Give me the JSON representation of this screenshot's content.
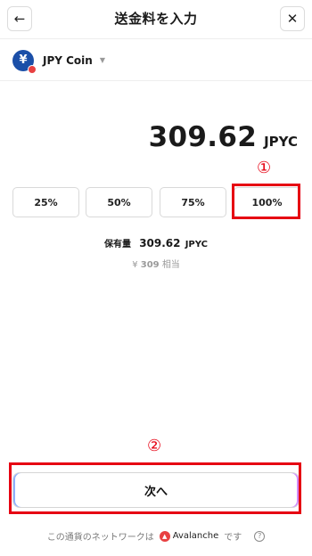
{
  "header": {
    "title": "送金料を入力",
    "back_glyph": "←",
    "close_glyph": "✕"
  },
  "coin": {
    "symbol": "¥",
    "name": "JPY Coin",
    "caret": "▼"
  },
  "amount": {
    "value": "309.62",
    "unit": "JPYC"
  },
  "percent_buttons": [
    "25%",
    "50%",
    "75%",
    "100%"
  ],
  "annotations": {
    "marker1": "①",
    "marker2": "②"
  },
  "holding": {
    "label": "保有量",
    "value": "309.62",
    "unit": "JPYC"
  },
  "equivalent": {
    "prefix": "¥",
    "value": "309",
    "suffix": "相当"
  },
  "next_button": {
    "label": "次へ"
  },
  "network_note": {
    "prefix": "この通貨のネットワークは",
    "network_icon_glyph": "▲",
    "network_name": "Avalanche",
    "suffix": "です",
    "help_glyph": "?"
  },
  "colors": {
    "annotation_red": "#e60012",
    "coin_blue": "#1b4fa8",
    "avalanche_red": "#e84142"
  }
}
